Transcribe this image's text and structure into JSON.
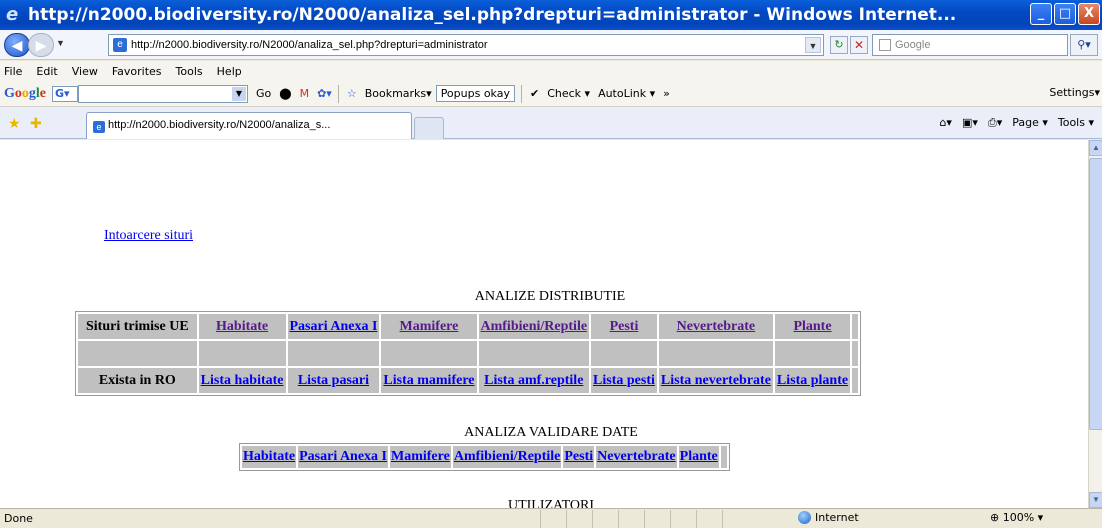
{
  "window": {
    "title": "http://n2000.biodiversity.ro/N2000/analiza_sel.php?drepturi=administrator - Windows Internet...",
    "minimize": "_",
    "maximize": "□",
    "close": "X"
  },
  "address_bar": {
    "url": "http://n2000.biodiversity.ro/N2000/analiza_sel.php?drepturi=administrator",
    "search_placeholder": "Google"
  },
  "menu": [
    "File",
    "Edit",
    "View",
    "Favorites",
    "Tools",
    "Help"
  ],
  "google_toolbar": {
    "go": "Go",
    "bookmarks": "Bookmarks▾",
    "popups": "Popups okay",
    "check": "Check ▾",
    "autolink": "AutoLink ▾",
    "more": "»",
    "settings": "Settings▾"
  },
  "tab": {
    "label": "http://n2000.biodiversity.ro/N2000/analiza_s..."
  },
  "command_bar": {
    "page": "Page ▾",
    "tools": "Tools ▾"
  },
  "content": {
    "back_link": "Intoarcere situri",
    "distribution_heading": "ANALIZE DISTRIBUTIE",
    "distribution_table": {
      "row1_label": "Situri trimise UE",
      "row1_links": [
        "Habitate",
        "Pasari Anexa I",
        "Mamifere",
        "Amfibieni/Reptile",
        "Pesti",
        "Nevertebrate",
        "Plante"
      ],
      "row3_label": "Exista in RO",
      "row3_links": [
        "Lista habitate",
        "Lista pasari",
        "Lista mamifere",
        "Lista amf.reptile",
        "Lista pesti",
        "Lista nevertebrate",
        "Lista plante"
      ]
    },
    "validation_heading": "ANALIZA VALIDARE DATE",
    "validation_links": [
      "Habitate",
      "Pasari Anexa I",
      "Mamifere",
      "Amfibieni/Reptile",
      "Pesti",
      "Nevertebrate",
      "Plante"
    ],
    "users_heading": "UTILIZATORI"
  },
  "status_bar": {
    "status": "Done",
    "zone": "Internet",
    "zoom": "100%"
  },
  "colors": {
    "link": "#0000ee",
    "visited_link": "#551a8b",
    "table_cell": "#c0c0c0",
    "title_bar": "#0349c4"
  }
}
